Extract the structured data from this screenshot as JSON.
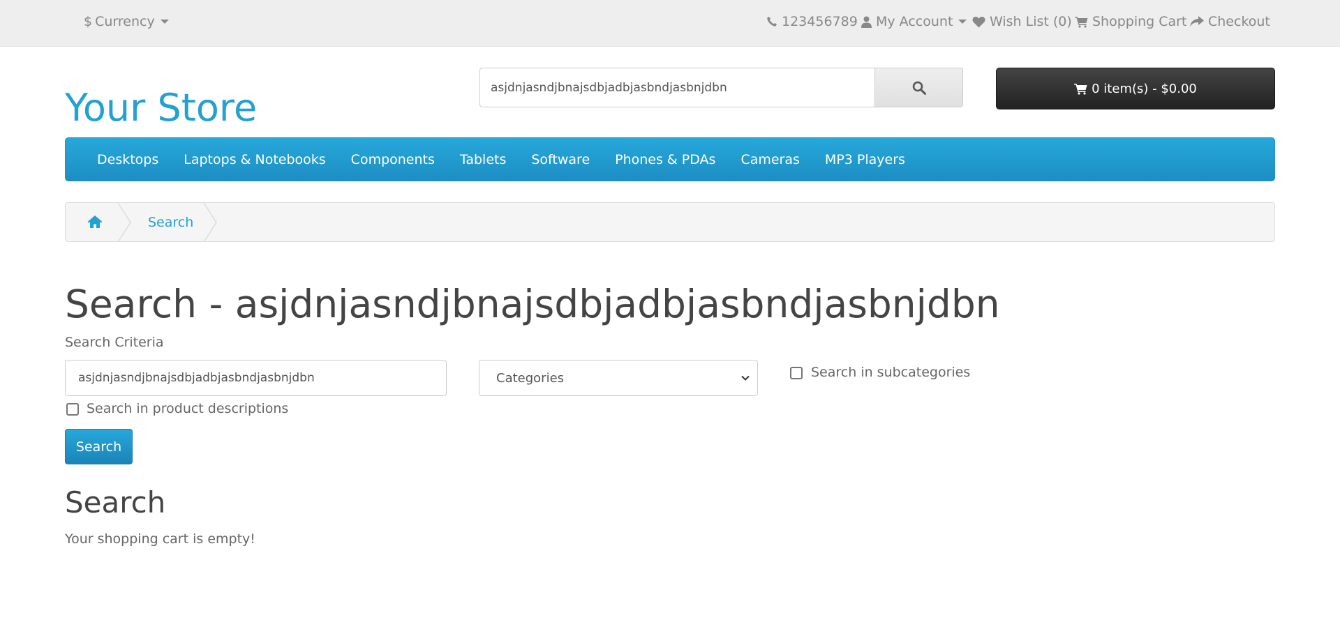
{
  "topbar": {
    "currency_symbol": "$",
    "currency_label": "Currency",
    "phone": "123456789",
    "my_account": "My Account",
    "wish_list": "Wish List (0)",
    "shopping_cart": "Shopping Cart",
    "checkout": "Checkout"
  },
  "header": {
    "logo": "Your Store",
    "search_value": "asjdnjasndjbnajsdbjadbjasbndjasbnjdbn",
    "cart_label": "0 item(s) - $0.00"
  },
  "menu": {
    "items": [
      "Desktops",
      "Laptops & Notebooks",
      "Components",
      "Tablets",
      "Software",
      "Phones & PDAs",
      "Cameras",
      "MP3 Players"
    ]
  },
  "breadcrumb": {
    "search_label": "Search"
  },
  "content": {
    "page_title": "Search - asjdnjasndjbnajsdbjadbjasbndjasbnjdbn",
    "criteria_label": "Search Criteria",
    "criteria_value": "asjdnjasndjbnajsdbjadbjasbndjasbnjdbn",
    "category_selected": "Categories",
    "subcategories_label": "Search in subcategories",
    "descriptions_label": "Search in product descriptions",
    "search_button": "Search",
    "results_title": "Search",
    "empty_message": "Your shopping cart is empty!"
  },
  "colors": {
    "accent": "#23a1d1",
    "topbar_bg": "#eeeeee",
    "cart_bg": "#333333"
  },
  "icons": {
    "phone": "phone-icon",
    "account": "user-icon",
    "wishlist": "heart-icon",
    "cart": "shopping-cart-icon",
    "checkout": "share-icon",
    "search": "search-icon",
    "home": "home-icon"
  }
}
